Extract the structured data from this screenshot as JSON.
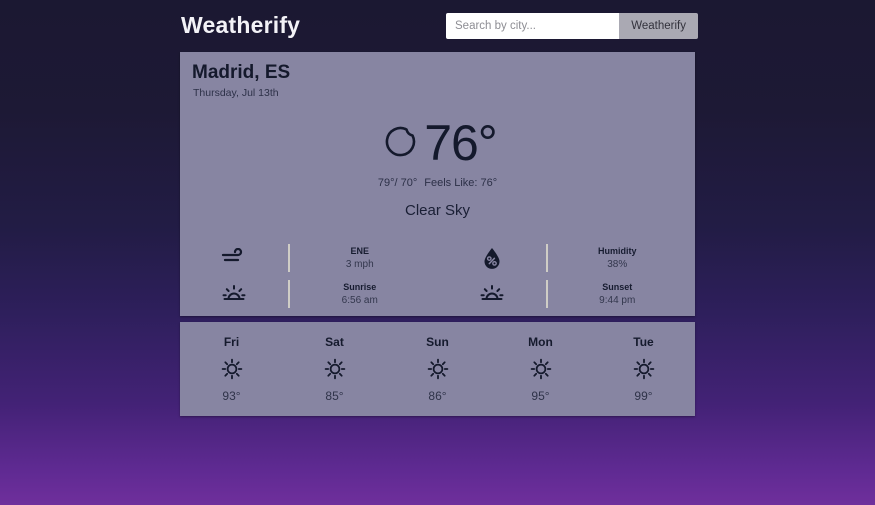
{
  "header": {
    "brand": "Weatherify",
    "search_placeholder": "Search by city...",
    "search_value": "",
    "search_button": "Weatherify"
  },
  "current": {
    "location": "Madrid, ES",
    "date": "Thursday, Jul 13th",
    "icon": "crescent-moon-icon",
    "temperature": "76°",
    "high_low": "79°/ 70°",
    "feels_like": "Feels Like: 76°",
    "condition": "Clear Sky",
    "details": [
      {
        "icon": "wind-icon",
        "label": "ENE",
        "value": "3 mph"
      },
      {
        "icon": "humidity-icon",
        "label": "Humidity",
        "value": "38%"
      },
      {
        "icon": "sunrise-icon",
        "label": "Sunrise",
        "value": "6:56 am"
      },
      {
        "icon": "sunset-icon",
        "label": "Sunset",
        "value": "9:44 pm"
      }
    ]
  },
  "forecast": [
    {
      "day": "Fri",
      "icon": "sun-icon",
      "temp": "93°"
    },
    {
      "day": "Sat",
      "icon": "sun-icon",
      "temp": "85°"
    },
    {
      "day": "Sun",
      "icon": "sun-icon",
      "temp": "86°"
    },
    {
      "day": "Mon",
      "icon": "sun-icon",
      "temp": "95°"
    },
    {
      "day": "Tue",
      "icon": "sun-icon",
      "temp": "99°"
    }
  ],
  "colors": {
    "card": "#8785a2",
    "ink": "#14192c",
    "background_top": "#1b1832",
    "background_bottom": "#6f2f9c",
    "button": "#aaa9b3"
  }
}
